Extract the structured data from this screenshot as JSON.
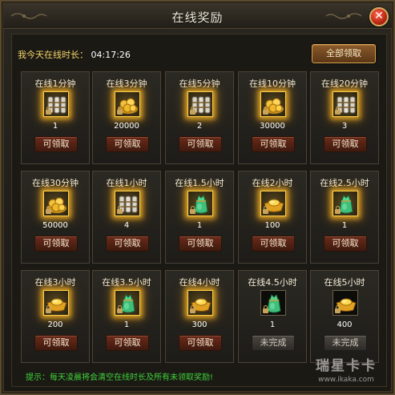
{
  "window": {
    "title": "在线奖励"
  },
  "header": {
    "online_time_label": "我今天在线时长：",
    "online_time_value": "04:17:26",
    "claim_all_label": "全部领取"
  },
  "rewards": [
    {
      "title": "在线1分钟",
      "icon": "scroll-bundle-icon",
      "amount": "1",
      "button": "可领取",
      "state": "claimable"
    },
    {
      "title": "在线3分钟",
      "icon": "gold-coins-icon",
      "amount": "20000",
      "button": "可领取",
      "state": "claimable"
    },
    {
      "title": "在线5分钟",
      "icon": "scroll-bundle-icon",
      "amount": "2",
      "button": "可领取",
      "state": "claimable"
    },
    {
      "title": "在线10分钟",
      "icon": "gold-coins-icon",
      "amount": "30000",
      "button": "可领取",
      "state": "claimable"
    },
    {
      "title": "在线20分钟",
      "icon": "scroll-bundle-icon",
      "amount": "3",
      "button": "可领取",
      "state": "claimable"
    },
    {
      "title": "在线30分钟",
      "icon": "gold-coins-icon",
      "amount": "50000",
      "button": "可领取",
      "state": "claimable"
    },
    {
      "title": "在线1小时",
      "icon": "scroll-bundle-icon",
      "amount": "4",
      "button": "可领取",
      "state": "claimable"
    },
    {
      "title": "在线1.5小时",
      "icon": "green-pouch-icon",
      "amount": "1",
      "button": "可领取",
      "state": "claimable"
    },
    {
      "title": "在线2小时",
      "icon": "gold-ingot-icon",
      "amount": "100",
      "button": "可领取",
      "state": "claimable"
    },
    {
      "title": "在线2.5小时",
      "icon": "green-pouch-icon",
      "amount": "1",
      "button": "可领取",
      "state": "claimable"
    },
    {
      "title": "在线3小时",
      "icon": "gold-ingot-icon",
      "amount": "200",
      "button": "可领取",
      "state": "claimable"
    },
    {
      "title": "在线3.5小时",
      "icon": "green-pouch-icon",
      "amount": "1",
      "button": "可领取",
      "state": "claimable"
    },
    {
      "title": "在线4小时",
      "icon": "gold-ingot-icon",
      "amount": "300",
      "button": "可领取",
      "state": "claimable"
    },
    {
      "title": "在线4.5小时",
      "icon": "green-pouch-icon",
      "amount": "1",
      "button": "未完成",
      "state": "incomplete"
    },
    {
      "title": "在线5小时",
      "icon": "gold-ingot-icon",
      "amount": "400",
      "button": "未完成",
      "state": "incomplete"
    }
  ],
  "footer": {
    "tip": "提示：每天凌晨将会清空在线时长及所有未领取奖励!",
    "watermark_main": "瑞星卡卡",
    "watermark_url": "www.ikaka.com"
  },
  "colors": {
    "highlight_text": "#f2d46a",
    "tip_text": "#3fd23a",
    "claim_button": "#5a2414",
    "incomplete_button": "#3c3834",
    "glow": "#ffc028"
  }
}
